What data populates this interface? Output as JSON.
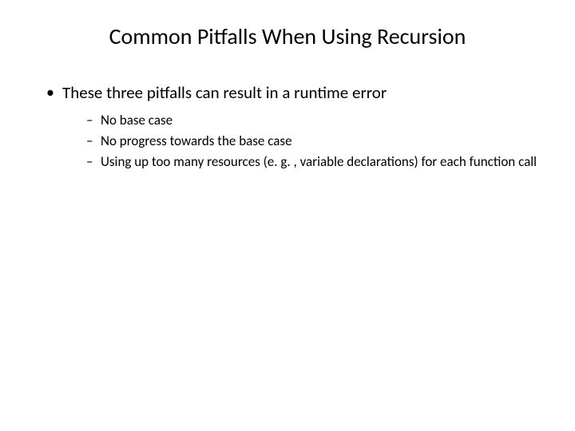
{
  "slide": {
    "title": "Common Pitfalls When Using Recursion",
    "bullets": [
      {
        "text": "These three pitfalls can result in a runtime error",
        "sub": [
          "No base case",
          "No progress towards the base case",
          "Using up too many resources (e. g. , variable declarations) for each function call"
        ]
      }
    ]
  }
}
